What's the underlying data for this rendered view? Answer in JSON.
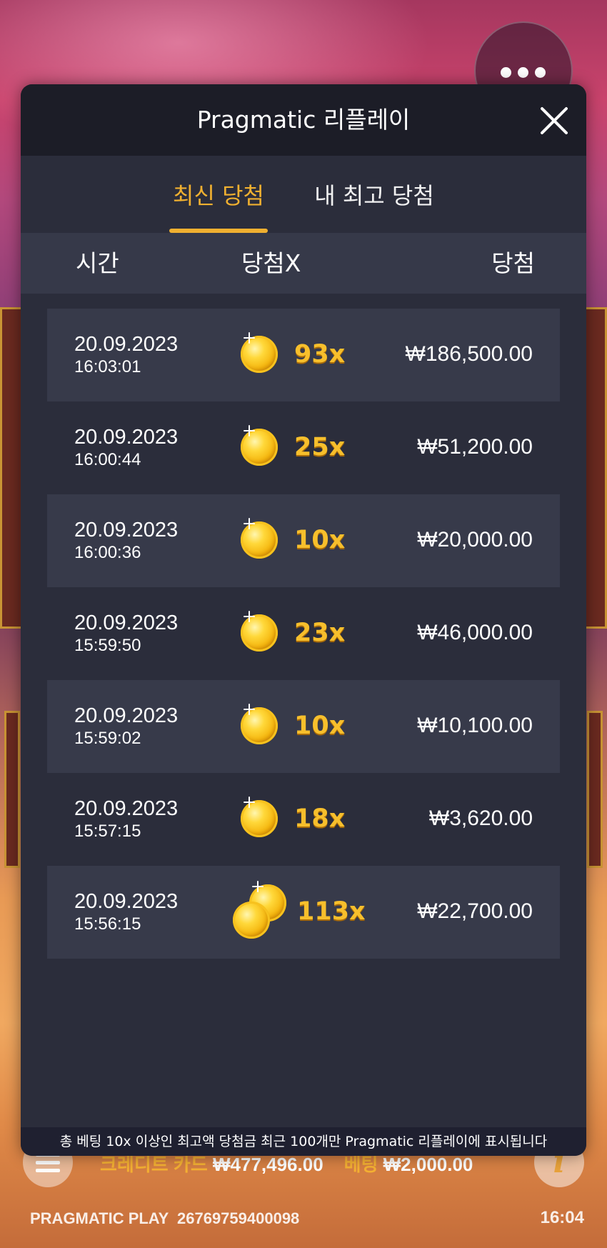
{
  "top_menu": {
    "icon": "more-dots-icon"
  },
  "modal": {
    "title": "Pragmatic 리플레이",
    "close_icon": "close-icon",
    "tabs": [
      {
        "label": "최신 당첨",
        "active": true
      },
      {
        "label": "내 최고 당첨",
        "active": false
      }
    ],
    "columns": {
      "time": "시간",
      "multiplier": "당첨X",
      "win": "당첨"
    },
    "rows": [
      {
        "date": "20.09.2023",
        "time": "16:03:01",
        "multiplier": "93x",
        "amount": "₩186,500.00",
        "coins": 1
      },
      {
        "date": "20.09.2023",
        "time": "16:00:44",
        "multiplier": "25x",
        "amount": "₩51,200.00",
        "coins": 1
      },
      {
        "date": "20.09.2023",
        "time": "16:00:36",
        "multiplier": "10x",
        "amount": "₩20,000.00",
        "coins": 1
      },
      {
        "date": "20.09.2023",
        "time": "15:59:50",
        "multiplier": "23x",
        "amount": "₩46,000.00",
        "coins": 1
      },
      {
        "date": "20.09.2023",
        "time": "15:59:02",
        "multiplier": "10x",
        "amount": "₩10,100.00",
        "coins": 1
      },
      {
        "date": "20.09.2023",
        "time": "15:57:15",
        "multiplier": "18x",
        "amount": "₩3,620.00",
        "coins": 1
      },
      {
        "date": "20.09.2023",
        "time": "15:56:15",
        "multiplier": "113x",
        "amount": "₩22,700.00",
        "coins": 2
      }
    ],
    "footer_note": "총 베팅 10x 이상인 최고액 당첨금 최근 100개만 Pragmatic 리플레이에 표시됩니다"
  },
  "game_bar": {
    "menu_icon": "hamburger-icon",
    "info_icon": "info-icon",
    "credit_label": "크레디트 카드",
    "credit_value": "₩477,496.00",
    "bet_label": "베팅",
    "bet_value": "₩2,000.00",
    "brand": "PRAGMATIC PLAY",
    "game_id": "26769759400098",
    "clock": "16:04"
  },
  "colors": {
    "accent": "#f0b030",
    "modal_bg": "#2b2d3b",
    "header_bg": "#1c1d27",
    "row_shaded": "#373a4a"
  }
}
